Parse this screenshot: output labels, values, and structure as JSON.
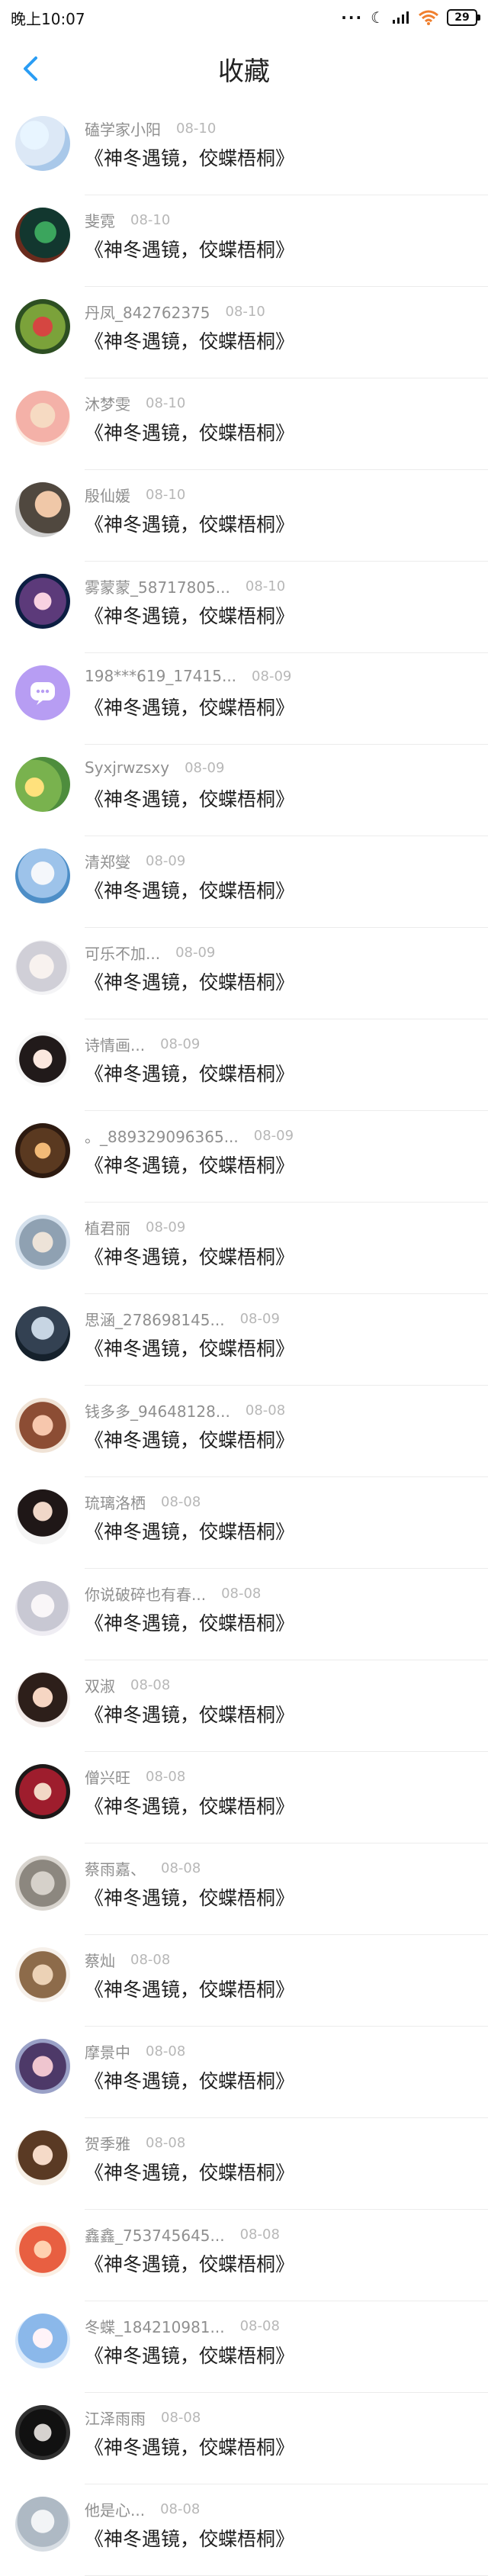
{
  "status": {
    "time": "晚上10:07",
    "battery": "29",
    "dots": "···"
  },
  "nav": {
    "title": "收藏"
  },
  "items": [
    {
      "name": "磕学家小阳",
      "date": "08-10",
      "book": "《神冬遇镜，佼蝶梧桐》"
    },
    {
      "name": "斐霓",
      "date": "08-10",
      "book": "《神冬遇镜，佼蝶梧桐》"
    },
    {
      "name": "丹凤_842762375",
      "date": "08-10",
      "book": "《神冬遇镜，佼蝶梧桐》"
    },
    {
      "name": "沐梦雯",
      "date": "08-10",
      "book": "《神冬遇镜，佼蝶梧桐》"
    },
    {
      "name": "殷仙媛",
      "date": "08-10",
      "book": "《神冬遇镜，佼蝶梧桐》"
    },
    {
      "name": "雾蒙蒙_58717805...",
      "date": "08-10",
      "book": "《神冬遇镜，佼蝶梧桐》"
    },
    {
      "name": "198***619_17415...",
      "date": "08-09",
      "book": "《神冬遇镜，佼蝶梧桐》"
    },
    {
      "name": "Syxjrwzsxy",
      "date": "08-09",
      "book": "《神冬遇镜，佼蝶梧桐》"
    },
    {
      "name": "清郑燮",
      "date": "08-09",
      "book": "《神冬遇镜，佼蝶梧桐》"
    },
    {
      "name": "可乐不加...",
      "date": "08-09",
      "book": "《神冬遇镜，佼蝶梧桐》"
    },
    {
      "name": "诗情画...",
      "date": "08-09",
      "book": "《神冬遇镜，佼蝶梧桐》"
    },
    {
      "name": "。_889329096365...",
      "date": "08-09",
      "book": "《神冬遇镜，佼蝶梧桐》"
    },
    {
      "name": "植君丽",
      "date": "08-09",
      "book": "《神冬遇镜，佼蝶梧桐》"
    },
    {
      "name": "思涵_278698145...",
      "date": "08-09",
      "book": "《神冬遇镜，佼蝶梧桐》"
    },
    {
      "name": "钱多多_94648128...",
      "date": "08-08",
      "book": "《神冬遇镜，佼蝶梧桐》"
    },
    {
      "name": "琉璃洛栖",
      "date": "08-08",
      "book": "《神冬遇镜，佼蝶梧桐》"
    },
    {
      "name": "你说破碎也有春...",
      "date": "08-08",
      "book": "《神冬遇镜，佼蝶梧桐》"
    },
    {
      "name": "双淑",
      "date": "08-08",
      "book": "《神冬遇镜，佼蝶梧桐》"
    },
    {
      "name": "僧兴旺",
      "date": "08-08",
      "book": "《神冬遇镜，佼蝶梧桐》"
    },
    {
      "name": "蔡雨嘉、",
      "date": "08-08",
      "book": "《神冬遇镜，佼蝶梧桐》"
    },
    {
      "name": "蔡灿",
      "date": "08-08",
      "book": "《神冬遇镜，佼蝶梧桐》"
    },
    {
      "name": "摩景中",
      "date": "08-08",
      "book": "《神冬遇镜，佼蝶梧桐》"
    },
    {
      "name": "贺季雅",
      "date": "08-08",
      "book": "《神冬遇镜，佼蝶梧桐》"
    },
    {
      "name": "鑫鑫_753745645...",
      "date": "08-08",
      "book": "《神冬遇镜，佼蝶梧桐》"
    },
    {
      "name": "冬蝶_184210981...",
      "date": "08-08",
      "book": "《神冬遇镜，佼蝶梧桐》"
    },
    {
      "name": "江泽雨雨",
      "date": "08-08",
      "book": "《神冬遇镜，佼蝶梧桐》"
    },
    {
      "name": "他是心...",
      "date": "08-08",
      "book": "《神冬遇镜，佼蝶梧桐》"
    }
  ],
  "colors": {
    "accent": "#2a9df4",
    "name": "#8f8f8f",
    "date": "#b7b7b7"
  }
}
